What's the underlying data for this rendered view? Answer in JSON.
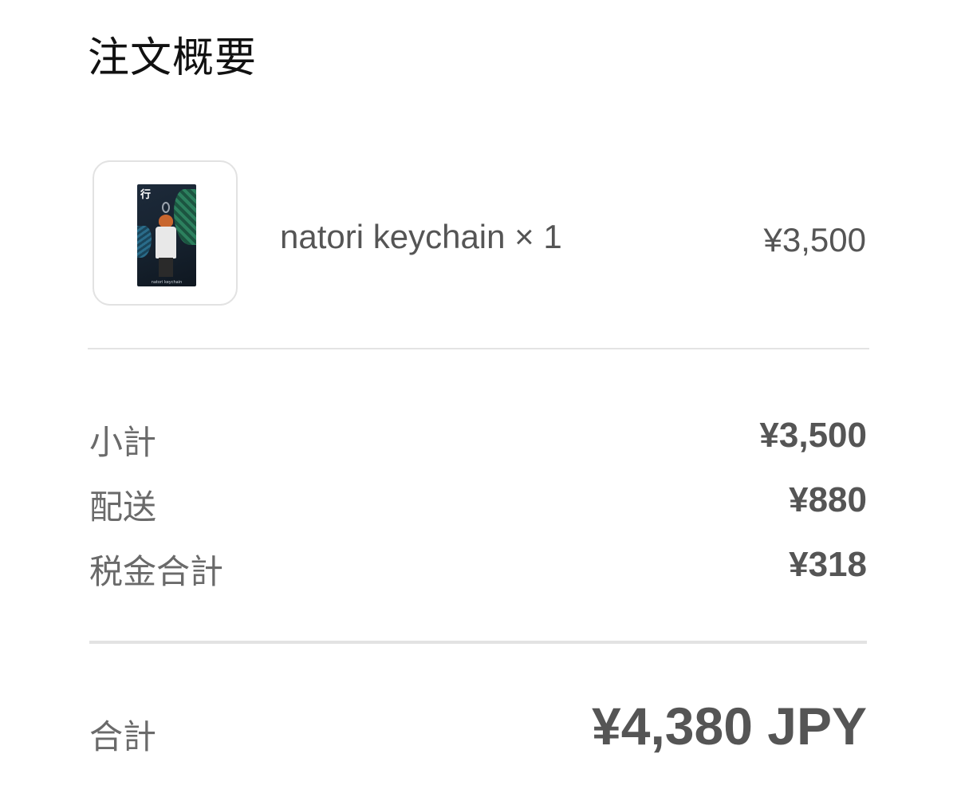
{
  "order_summary": {
    "title": "注文概要",
    "item": {
      "thumbnail_label": "行",
      "thumbnail_caption": "natori keychain",
      "name": "natori keychain × 1",
      "price": "¥3,500"
    },
    "lines": [
      {
        "label": "小計",
        "value": "¥3,500"
      },
      {
        "label": "配送",
        "value": "¥880"
      },
      {
        "label": "税金合計",
        "value": "¥318"
      }
    ],
    "total": {
      "label": "合計",
      "value": "¥4,380 JPY"
    }
  }
}
